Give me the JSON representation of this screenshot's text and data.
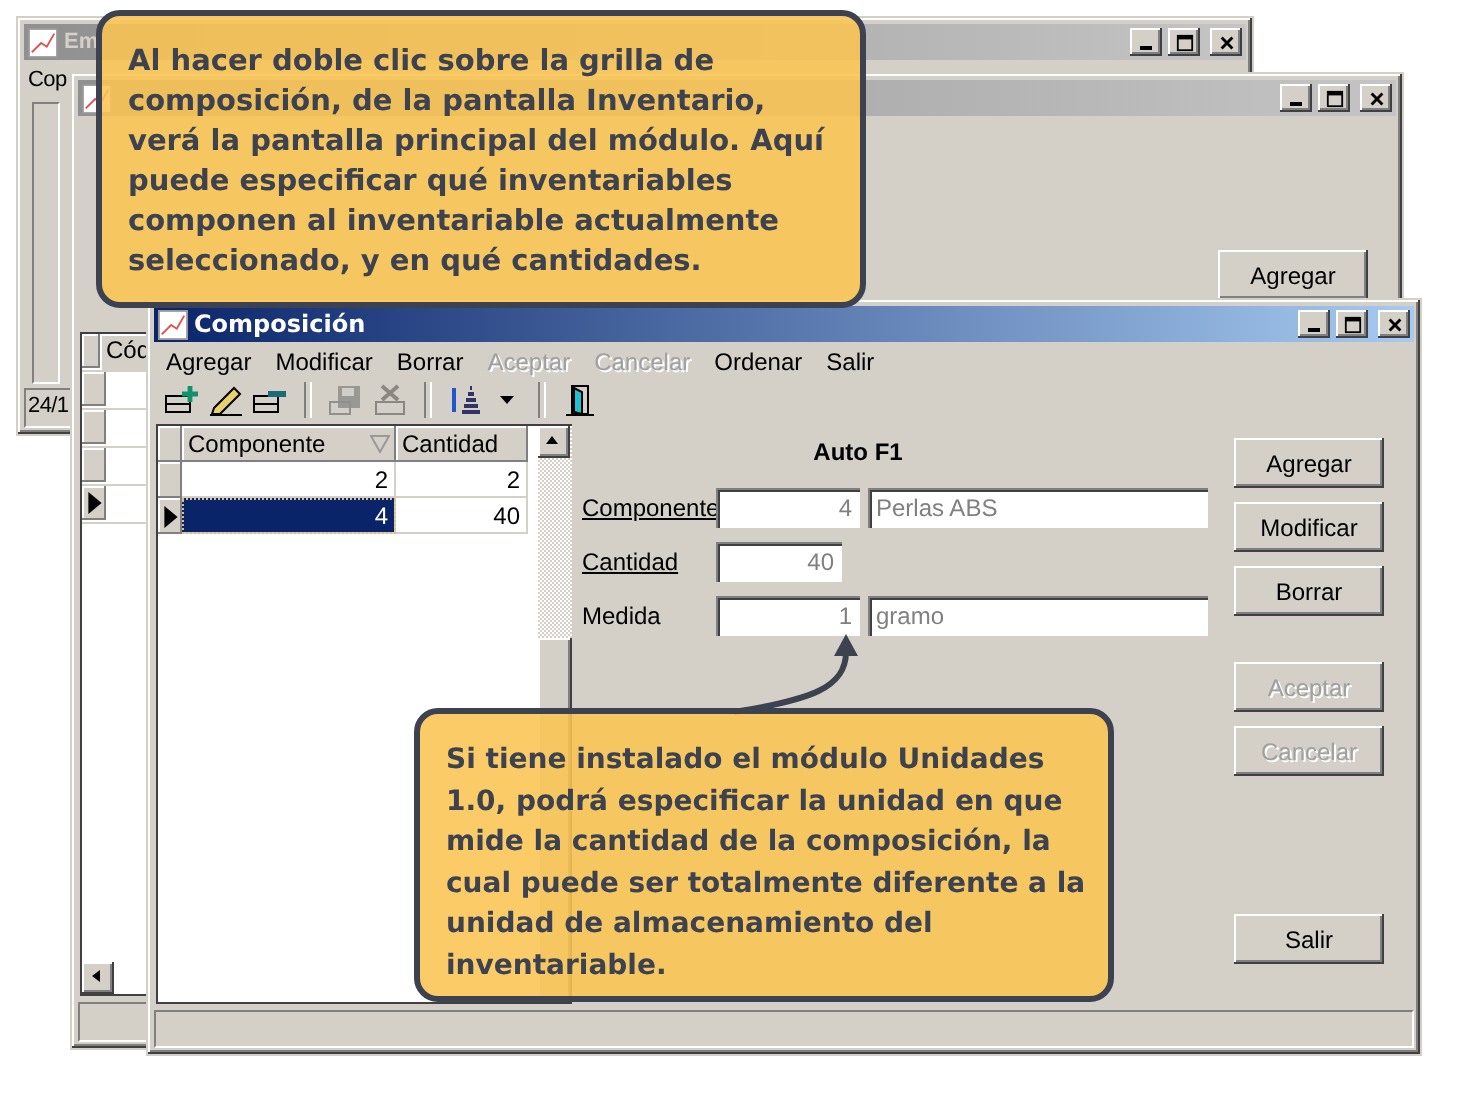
{
  "empresas_window": {
    "title": "Em",
    "menu_item": "Cop",
    "status_text": "24/1"
  },
  "inventario_window": {
    "grid_column": "Cód",
    "buttons": [
      {
        "label": "Agregar"
      }
    ]
  },
  "composicion_window": {
    "title": "Composición",
    "menu": [
      {
        "label": "Agregar",
        "disabled": false
      },
      {
        "label": "Modificar",
        "disabled": false
      },
      {
        "label": "Borrar",
        "disabled": false
      },
      {
        "label": "Aceptar",
        "disabled": true
      },
      {
        "label": "Cancelar",
        "disabled": true
      },
      {
        "label": "Ordenar",
        "disabled": false
      },
      {
        "label": "Salir",
        "disabled": false
      }
    ],
    "toolbar": [
      {
        "kind": "add",
        "disabled": false
      },
      {
        "kind": "edit",
        "disabled": false
      },
      {
        "kind": "remove",
        "disabled": false
      },
      {
        "kind": "separator"
      },
      {
        "kind": "save",
        "disabled": true
      },
      {
        "kind": "cancel",
        "disabled": true
      },
      {
        "kind": "separator"
      },
      {
        "kind": "sort",
        "disabled": false
      },
      {
        "kind": "separator"
      },
      {
        "kind": "exit",
        "disabled": false
      }
    ],
    "grid": {
      "columns": [
        "Componente",
        "Cantidad"
      ],
      "rows": [
        {
          "cells": [
            "2",
            "2"
          ],
          "selected": false
        },
        {
          "cells": [
            "4",
            "40"
          ],
          "selected": true
        }
      ]
    },
    "heading": "Auto F1",
    "fields": [
      {
        "label": "Componente",
        "underlined": true,
        "code": "4",
        "value": "Perlas ABS"
      },
      {
        "label": "Cantidad",
        "underlined": true,
        "code": "40"
      },
      {
        "label": "Medida",
        "underlined": false,
        "code": "1",
        "value": "gramo"
      }
    ],
    "buttons": [
      {
        "label": "Agregar",
        "disabled": false
      },
      {
        "label": "Modificar",
        "disabled": false
      },
      {
        "label": "Borrar",
        "disabled": false
      },
      {
        "label": "Aceptar",
        "disabled": true
      },
      {
        "label": "Cancelar",
        "disabled": true
      },
      {
        "label": "Salir",
        "disabled": false
      }
    ]
  },
  "callouts": [
    {
      "text": "Al hacer doble clic sobre la grilla de composición,  de la pantalla Inventario, verá la pantalla principal del módulo. Aquí puede especificar qué inventariables componen al inventariable actualmente seleccionado, y en qué cantidades."
    },
    {
      "text": "Si tiene instalado el módulo Unidades 1.0, podrá especificar la unidad en que mide la cantidad de la composición, la cual puede ser totalmente diferente a la unidad de almacenamiento del inventariable."
    }
  ]
}
